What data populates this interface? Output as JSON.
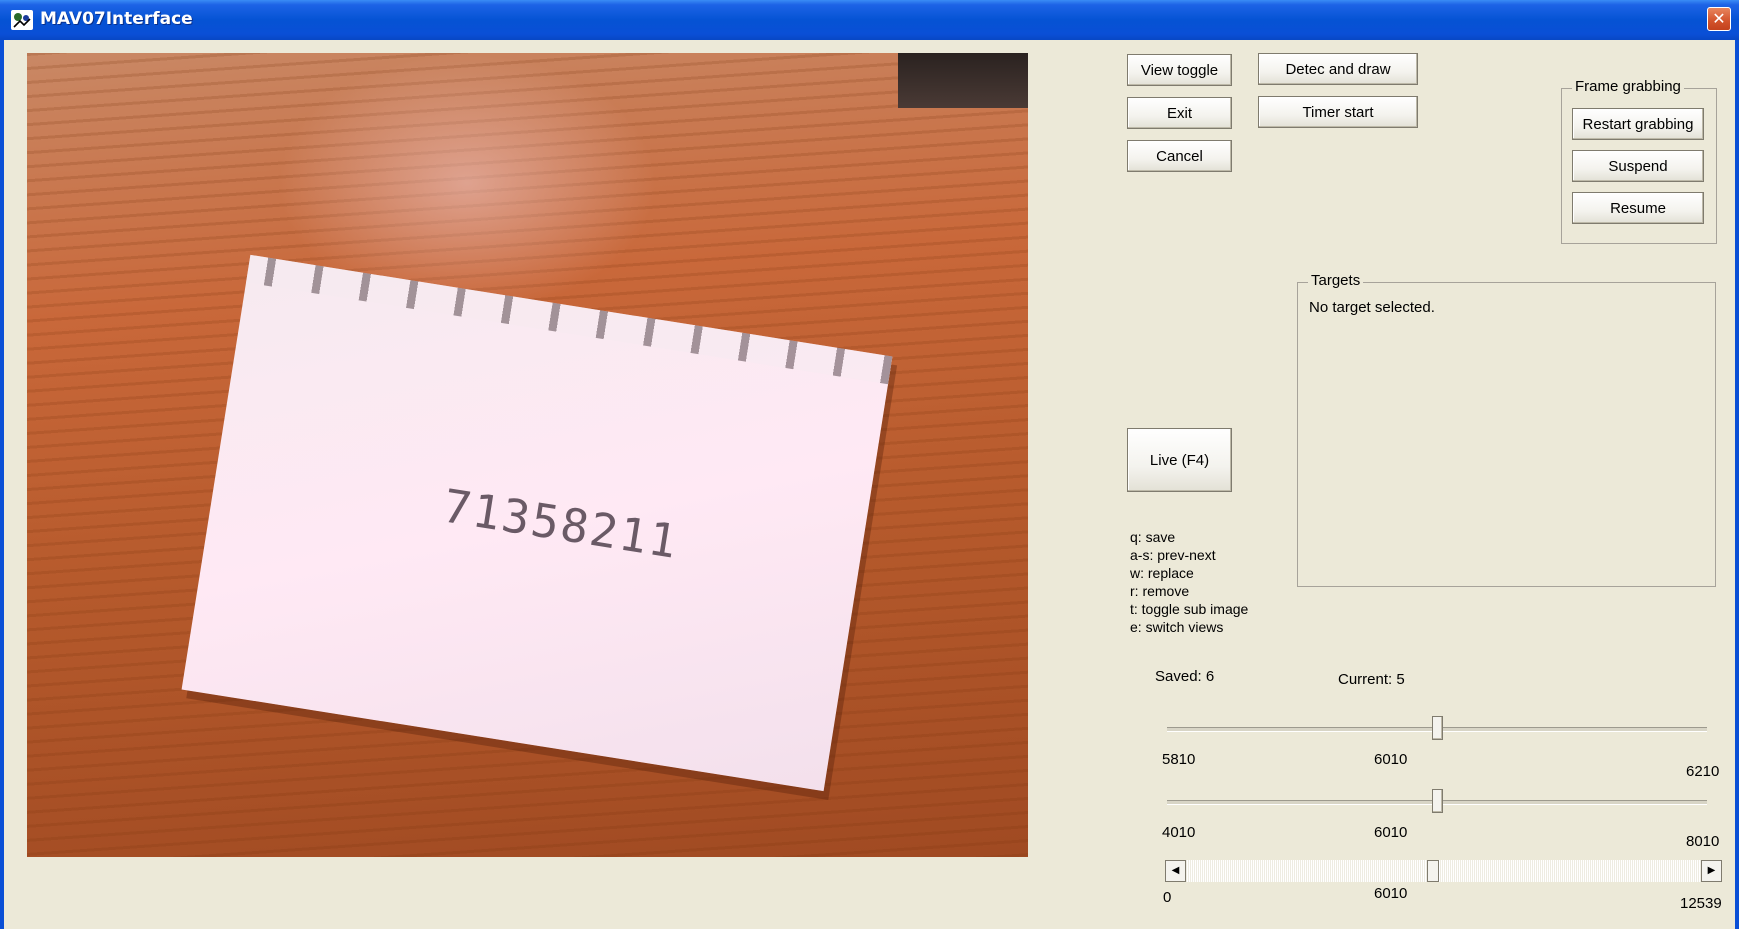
{
  "window": {
    "title": "MAV07Interface",
    "close_glyph": "✕"
  },
  "camera": {
    "paper_number": "71358211"
  },
  "buttons": {
    "view_toggle": "View toggle",
    "exit": "Exit",
    "cancel": "Cancel",
    "detect_and_draw": "Detec and draw",
    "timer_start": "Timer start",
    "live": "Live (F4)"
  },
  "frame_grabbing": {
    "caption": "Frame grabbing",
    "restart": "Restart grabbing",
    "suspend": "Suspend",
    "resume": "Resume"
  },
  "targets": {
    "caption": "Targets",
    "text": "No target selected."
  },
  "shortcuts": [
    "q: save",
    "a-s: prev-next",
    "w: replace",
    "r: remove",
    "t: toggle sub image",
    "e: switch views"
  ],
  "status": {
    "saved": "Saved: 6",
    "current": "Current: 5"
  },
  "slider1": {
    "min": "5810",
    "value": "6010",
    "max": "6210",
    "fraction": 0.5
  },
  "slider2": {
    "min": "4010",
    "value": "6010",
    "max": "8010",
    "fraction": 0.5
  },
  "scroll": {
    "min": "0",
    "value": "6010",
    "max": "12539",
    "fraction": 0.479,
    "left_arrow": "◀",
    "right_arrow": "▶"
  },
  "icons": [
    "app-icon",
    "close-icon",
    "scroll-left-icon",
    "scroll-right-icon"
  ]
}
